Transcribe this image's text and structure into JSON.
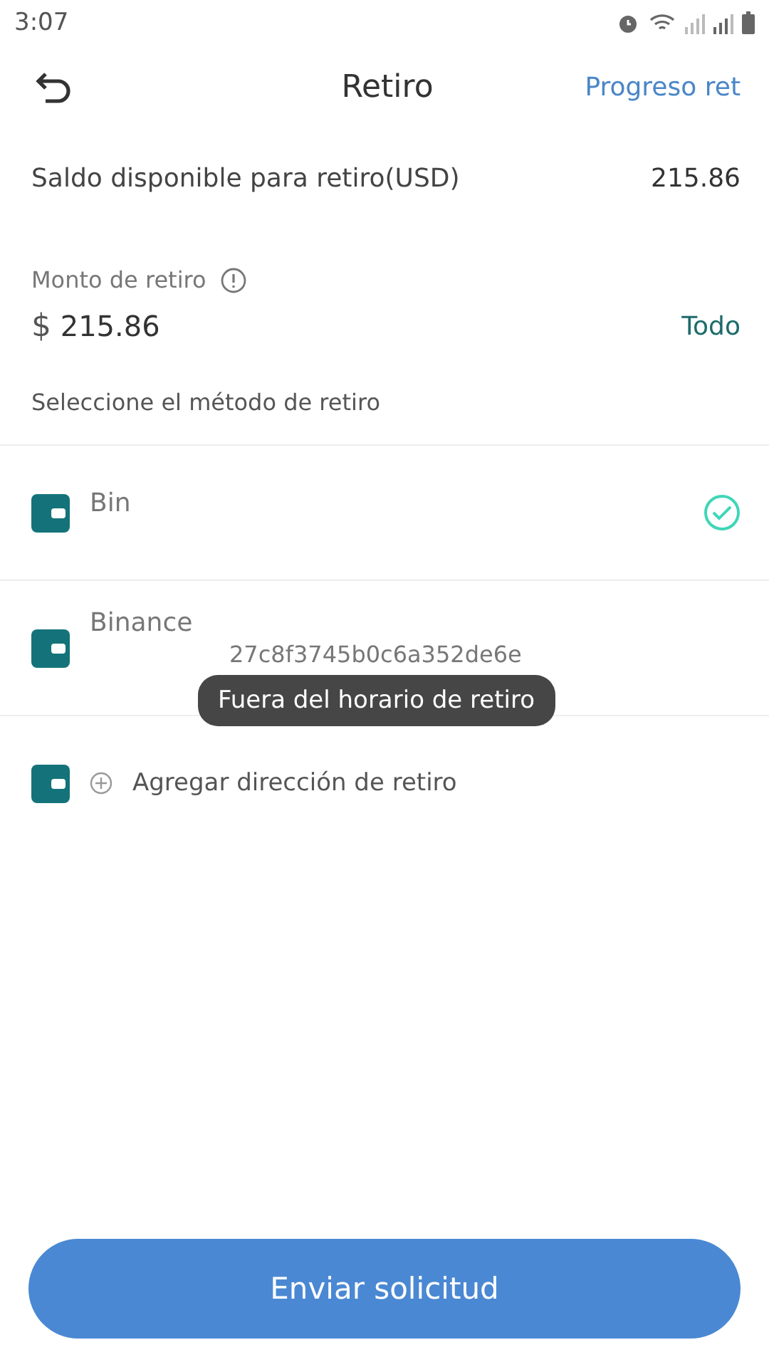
{
  "status_bar": {
    "time": "3:07"
  },
  "header": {
    "title": "Retiro",
    "action": "Progreso ret"
  },
  "balance": {
    "label": "Saldo disponible para retiro(USD)",
    "value": "215.86"
  },
  "amount": {
    "label": "Monto de retiro",
    "currency": "$",
    "value": "215.86",
    "all_button": "Todo"
  },
  "method_label": "Seleccione el método de retiro",
  "methods": [
    {
      "name": "Bin",
      "selected": true
    },
    {
      "name": "Binance",
      "address": "27c8f3745b0c6a352de6e",
      "selected": false
    }
  ],
  "add_method": "Agregar dirección de retiro",
  "toast": "Fuera del horario de retiro",
  "submit": "Enviar solicitud"
}
